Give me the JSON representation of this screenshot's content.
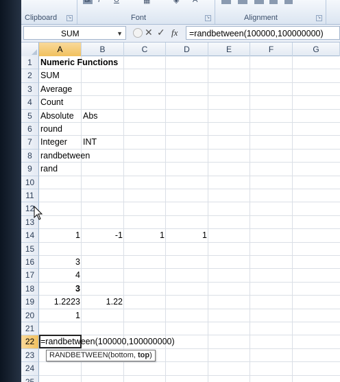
{
  "ribbon": {
    "groups": [
      {
        "label": "Clipboard"
      },
      {
        "label": "Font"
      },
      {
        "label": "Alignment"
      }
    ]
  },
  "formula_bar": {
    "name_box": "SUM",
    "formula": "=randbetween(100000,100000000)"
  },
  "sheet": {
    "columns": [
      "A",
      "B",
      "C",
      "D",
      "E",
      "F",
      "G"
    ],
    "rows": [
      "1",
      "2",
      "3",
      "4",
      "5",
      "6",
      "7",
      "8",
      "9",
      "10",
      "11",
      "12",
      "13",
      "14",
      "15",
      "16",
      "17",
      "18",
      "19",
      "20",
      "21",
      "22",
      "23",
      "24",
      "25"
    ],
    "cells": {
      "A1": "Numeric Functions",
      "A2": "SUM",
      "A3": "Average",
      "A4": "Count",
      "A5": "Absolute",
      "B5": "Abs",
      "A6": "round",
      "A7": "Integer",
      "B7": "INT",
      "A8": "randbetween",
      "A9": "rand",
      "A14": "1",
      "B14": "-1",
      "C14": "1",
      "D14": "1",
      "A16": "3",
      "A17": "4",
      "A18": "3",
      "A19": "1.2223",
      "B19": "1.22",
      "A20": "1",
      "A22": "=randbetween(100000,100000000)"
    },
    "active_cell": "A22"
  },
  "tooltip": {
    "func": "RANDBETWEEN(bottom, ",
    "bold_arg": "top",
    "close": ")"
  }
}
